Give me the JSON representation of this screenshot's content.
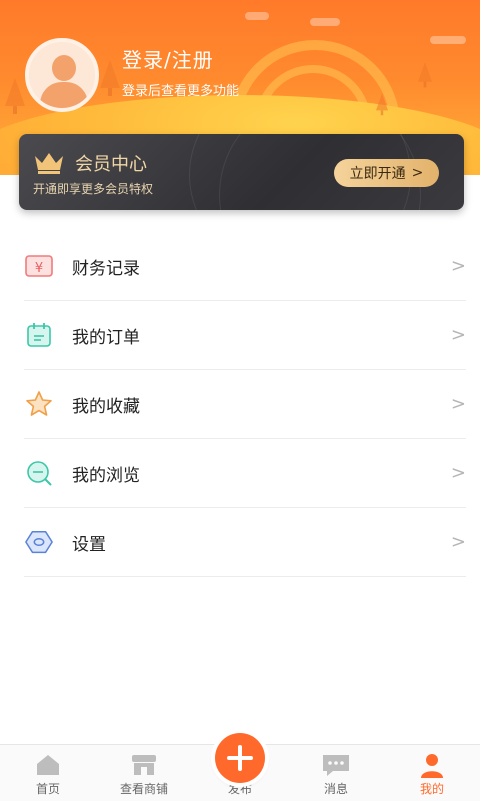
{
  "profile": {
    "title": "登录/注册",
    "subtitle": "登录后查看更多功能"
  },
  "vip": {
    "title": "会员中心",
    "subtitle": "开通即享更多会员特权",
    "button_label": "立即开通",
    "button_arrow": ">"
  },
  "menu": {
    "items": [
      {
        "label": "财务记录",
        "icon": "finance-icon",
        "chevron": ">"
      },
      {
        "label": "我的订单",
        "icon": "order-icon",
        "chevron": ">"
      },
      {
        "label": "我的收藏",
        "icon": "star-icon",
        "chevron": ">"
      },
      {
        "label": "我的浏览",
        "icon": "browse-icon",
        "chevron": ">"
      },
      {
        "label": "设置",
        "icon": "settings-icon",
        "chevron": ">"
      }
    ]
  },
  "tabbar": {
    "tabs": [
      {
        "label": "首页",
        "icon": "home-icon"
      },
      {
        "label": "查看商铺",
        "icon": "shop-icon"
      },
      {
        "label": "发布",
        "icon": "plus-icon"
      },
      {
        "label": "消息",
        "icon": "message-icon"
      },
      {
        "label": "我的",
        "icon": "user-icon"
      }
    ],
    "active_color": "#ff6a2c",
    "inactive_color": "#666666"
  },
  "colors": {
    "accent": "#ff6a2c",
    "vip_gold": "#f2d7a6"
  }
}
